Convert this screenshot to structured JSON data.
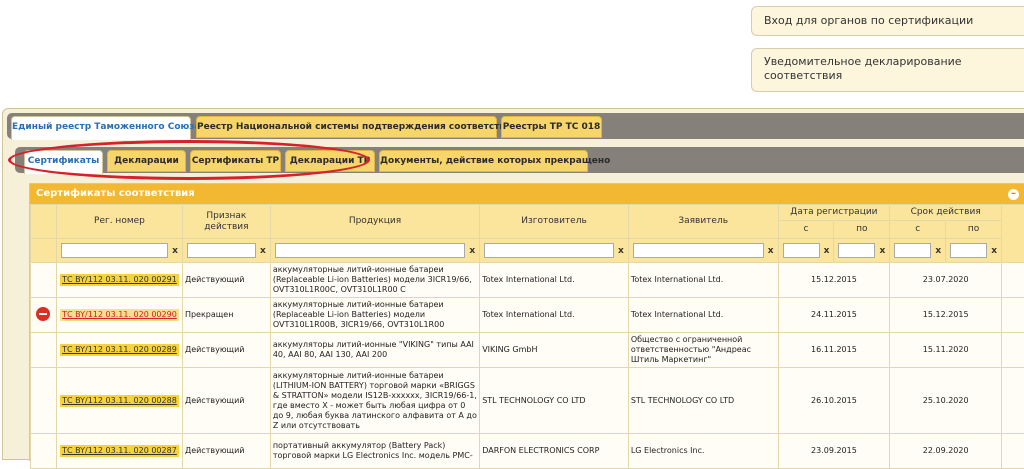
{
  "side_buttons": {
    "certification_login": "Вход для органов по сертификации",
    "notification_declaration": "Уведомительное декларирование соответствия"
  },
  "top_tabs": [
    "Единый реестр Таможенного Союза",
    "Реестр Национальной системы подтверждения соответствия",
    "Реестры ТР ТС 018"
  ],
  "sub_tabs": [
    "Сертификаты",
    "Декларации",
    "Сертификаты ТР",
    "Декларации ТР",
    "Документы, действие которых прекращено"
  ],
  "grid": {
    "title": "Сертификаты соответствия",
    "columns": {
      "reg_number": "Рег. номер",
      "status": "Признак действия",
      "product": "Продукция",
      "manufacturer": "Изготовитель",
      "applicant": "Заявитель",
      "reg_date": "Дата регистрации",
      "validity": "Срок действия",
      "from": "с",
      "to": "по"
    },
    "clear_symbol": "x",
    "rows": [
      {
        "reg": "ТС BY/112 03.11. 020 00291",
        "status": "Действующий",
        "product": "аккумуляторные литий-ионные батареи (Replaceable Li-ion Batteries) модели 3ICR19/66, OVT310L1R00C, OVT310L1R00 C",
        "manufacturer": "Totex International Ltd.",
        "applicant": "Totex International Ltd.",
        "reg_date": "15.12.2015",
        "valid_to": "23.07.2020"
      },
      {
        "reg": "ТС BY/112 03.11. 020 00290",
        "status": "Прекращен",
        "product": "аккумуляторные литий-ионные батареи (Replaceable Li-ion Batteries) модели OVT310L1R00B, 3ICR19/66, OVT310L1R00",
        "manufacturer": "Totex International Ltd.",
        "applicant": "Totex International Ltd.",
        "reg_date": "24.11.2015",
        "valid_to": "15.12.2015"
      },
      {
        "reg": "ТС BY/112 03.11. 020 00289",
        "status": "Действующий",
        "product": "аккумуляторы литий-ионные \"VIKING\" типы AAI 40, AAI 80, AAI 130, AAI 200",
        "manufacturer": "VIKING GmbH",
        "applicant": "Общество с ограниченной ответственностью \"Андреас Штиль Маркетинг\"",
        "reg_date": "16.11.2015",
        "valid_to": "15.11.2020"
      },
      {
        "reg": "ТС BY/112 03.11. 020 00288",
        "status": "Действующий",
        "product": "аккумуляторные литий-ионные батареи (LITHIUM-ION BATTERY) торговой марки «BRIGGS & STRATTON» модели IS12B-xxxxxx, 3ICR19/66-1, где вместо X - может быть любая цифра от 0 до 9, любая буква латинского алфавита от A до Z или отсутствовать",
        "manufacturer": "STL TECHNOLOGY CO LTD",
        "applicant": "STL TECHNOLOGY CO LTD",
        "reg_date": "26.10.2015",
        "valid_to": "25.10.2020"
      },
      {
        "reg": "ТС BY/112 03.11. 020 00287",
        "status": "Действующий",
        "product": "портативный аккумулятор (Battery Pack) торговой марки LG Electronics Inc. модель PMC-",
        "manufacturer": "DARFON ELECTRONICS CORP",
        "applicant": "LG Electronics Inc.",
        "reg_date": "23.09.2015",
        "valid_to": "22.09.2020"
      }
    ]
  }
}
